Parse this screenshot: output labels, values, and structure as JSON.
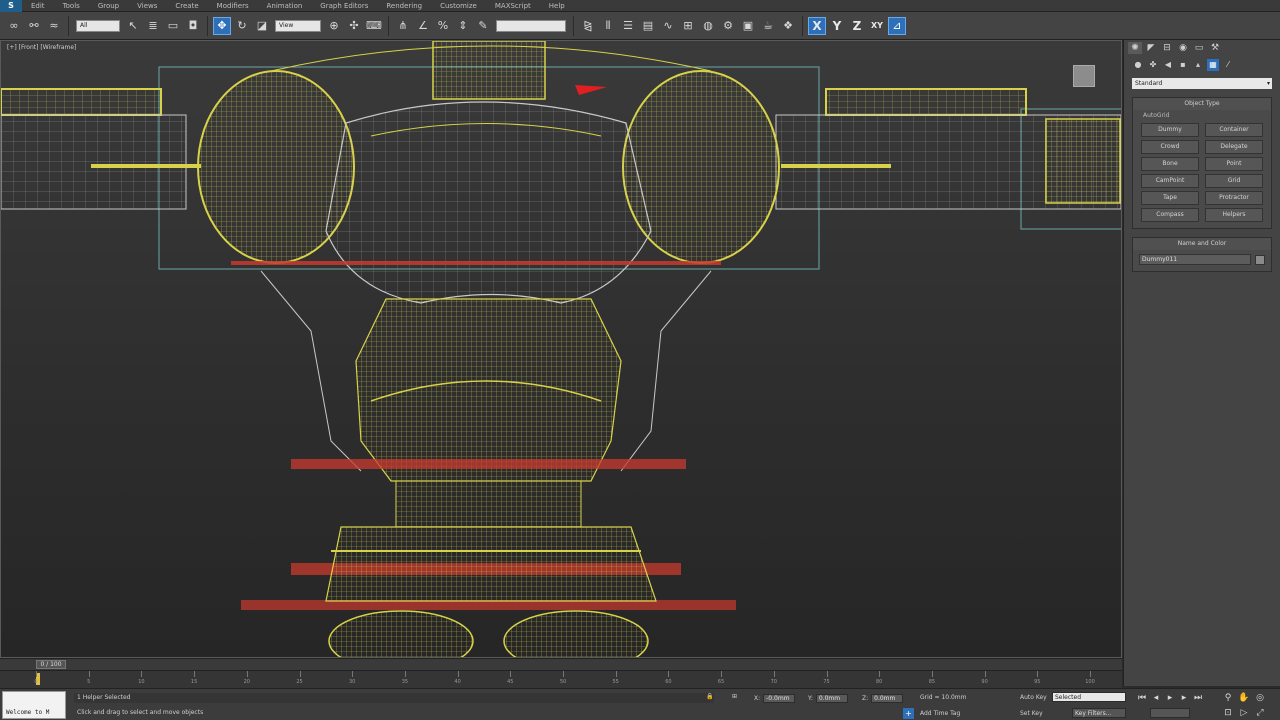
{
  "menu": {
    "app_logo": "S",
    "items": [
      "Edit",
      "Tools",
      "Group",
      "Views",
      "Create",
      "Modifiers",
      "Animation",
      "Graph Editors",
      "Rendering",
      "Customize",
      "MAXScript",
      "Help"
    ]
  },
  "toolbar": {
    "selection_filter": "All",
    "reference_coord": "View",
    "named_selection": "",
    "axis_labels": [
      "X",
      "Y",
      "Z",
      "XY"
    ]
  },
  "viewport": {
    "label": "[+] [Front] [Wireframe]"
  },
  "command_panel": {
    "category": "Standard",
    "object_type_title": "Object Type",
    "autogrid_label": "AutoGrid",
    "object_buttons": [
      "Dummy",
      "Container",
      "Crowd",
      "Delegate",
      "Bone",
      "Point",
      "CamPoint",
      "Grid",
      "Tape",
      "Protractor",
      "Compass",
      "Helpers"
    ],
    "name_color_title": "Name and Color",
    "object_name": "Dummy011"
  },
  "timeline": {
    "slider_label": "0 / 100",
    "ticks": [
      "0",
      "5",
      "10",
      "15",
      "20",
      "25",
      "30",
      "35",
      "40",
      "45",
      "50",
      "55",
      "60",
      "65",
      "70",
      "75",
      "80",
      "85",
      "90",
      "95",
      "100"
    ]
  },
  "status": {
    "maxscript_text": "Welcome to M",
    "selection_text": "1 Helper Selected",
    "prompt_text": "Click and drag to select and move objects",
    "x_label": "X:",
    "x_value": "-0.0mm",
    "y_label": "Y:",
    "y_value": "0.0mm",
    "z_label": "Z:",
    "z_value": "0.0mm",
    "grid_text": "Grid = 10.0mm",
    "autokey_label": "Auto Key",
    "setkey_label": "Set Key",
    "keymode_value": "Selected",
    "key_filters_label": "Key Filters...",
    "add_time_tag": "Add Time Tag"
  },
  "colors": {
    "wire_yellow": "#d8d24a",
    "wire_white": "#c8c8c8",
    "wire_red": "#c83a2e",
    "accent_blue": "#2d6fb8"
  }
}
